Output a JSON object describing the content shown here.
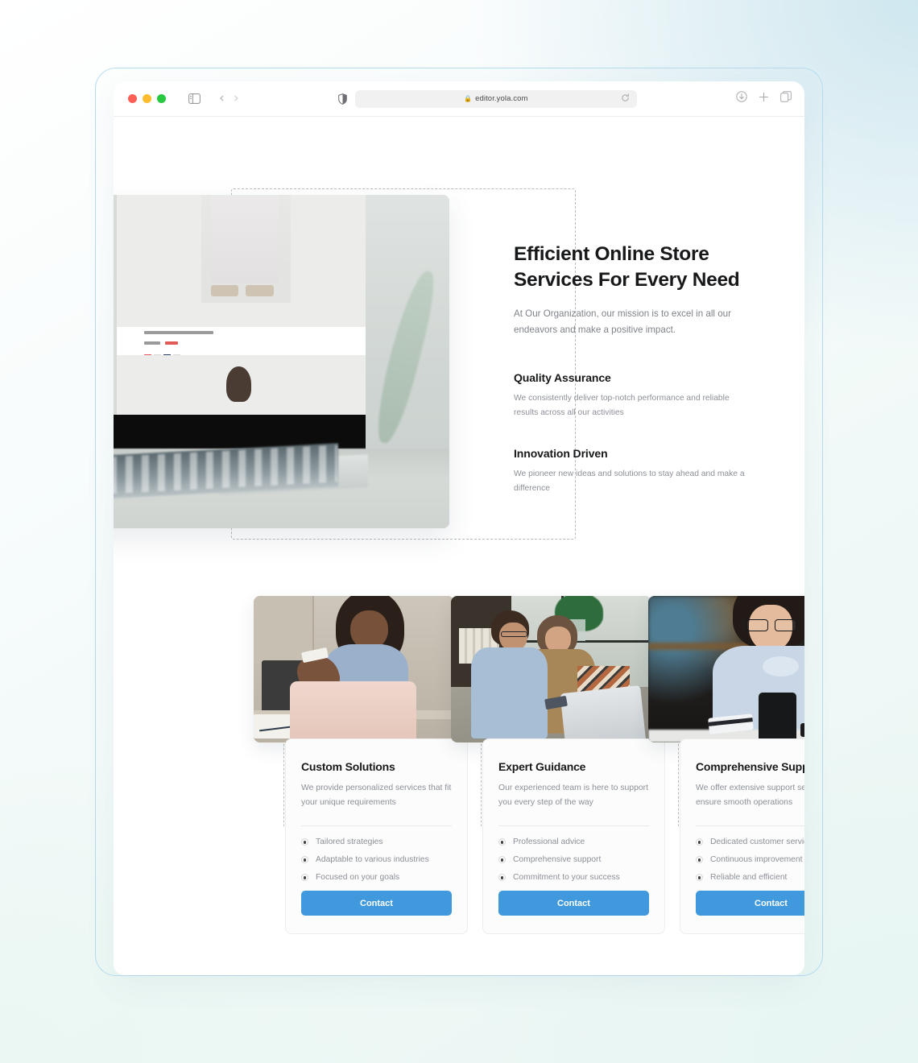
{
  "browser": {
    "url": "editor.yola.com",
    "lock_icon": "lock-icon",
    "traffic_lights": [
      "close-red",
      "minimize-yellow",
      "zoom-green"
    ],
    "sidebar_icon": "sidebar-toggle-icon",
    "back_icon": "‹",
    "forward_icon": "›",
    "shield_icon": "privacy-shield-icon",
    "reload_icon": "↻",
    "download_icon": "download-icon",
    "new_tab_icon": "+",
    "tab_overview_icon": "tab-overview-icon"
  },
  "hero": {
    "heading_line1": "Efficient Online Store",
    "heading_line2": "Services For Every Need",
    "subtitle": "At Our Organization, our mission is to excel in all our endeavors and make a positive impact.",
    "image_alt": "laptop-showing-online-clothing-store",
    "features": [
      {
        "title": "Quality Assurance",
        "text": "We consistently deliver top-notch performance and reliable results across all our activities"
      },
      {
        "title": "Innovation Driven",
        "text": "We pioneer new ideas and solutions to stay ahead and make a difference"
      }
    ]
  },
  "cards": [
    {
      "title": "Custom Solutions",
      "description": "We provide personalized services that fit your unique requirements",
      "bullets": [
        "Tailored strategies",
        "Adaptable to various industries",
        "Focused on your goals"
      ],
      "button": "Contact",
      "image_alt": "woman-shopping-online-with-laptop-and-credit-card"
    },
    {
      "title": "Expert Guidance",
      "description": "Our experienced team is here to support you every step of the way",
      "bullets": [
        "Professional advice",
        "Comprehensive support",
        "Commitment to your success"
      ],
      "button": "Contact",
      "image_alt": "couple-shopping-online-on-couch"
    },
    {
      "title": "Comprehensive Support",
      "description": "We offer extensive support services to ensure smooth operations",
      "bullets": [
        "Dedicated customer service",
        "Continuous improvement",
        "Reliable and efficient"
      ],
      "button": "Contact",
      "image_alt": "woman-with-phone-and-credit-card"
    }
  ],
  "colors": {
    "accent": "#3f99dc",
    "heading": "#17181a",
    "body_text": "#8b9097",
    "frame_border": "#b7dcef",
    "selection_dash": "#b9b9b9"
  }
}
